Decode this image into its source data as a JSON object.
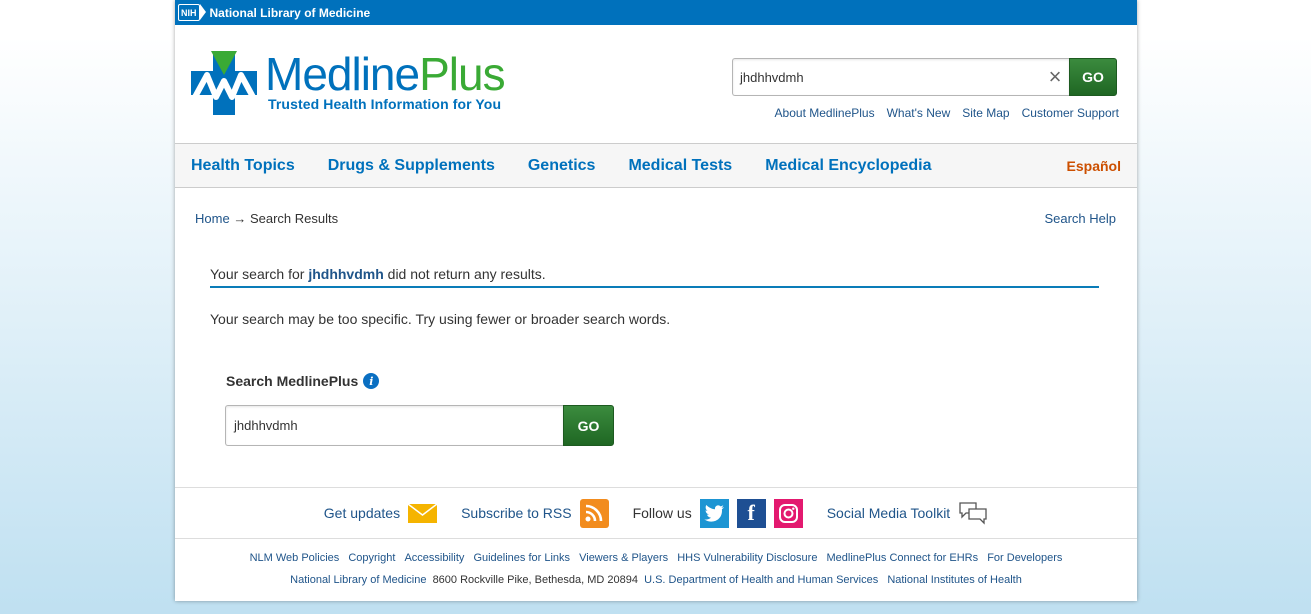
{
  "nih_bar": {
    "badge": "NIH",
    "label": "National Library of Medicine"
  },
  "logo": {
    "name_part1": "Medline",
    "name_part2": "Plus",
    "tagline": "Trusted Health Information for You"
  },
  "header_search": {
    "value": "jhdhhvdmh",
    "button": "GO"
  },
  "top_links": [
    "About MedlinePlus",
    "What's New",
    "Site Map",
    "Customer Support"
  ],
  "nav": {
    "items": [
      "Health Topics",
      "Drugs & Supplements",
      "Genetics",
      "Medical Tests",
      "Medical Encyclopedia"
    ],
    "espanol": "Español"
  },
  "breadcrumb": {
    "home": "Home",
    "arrow": "→",
    "current": "Search Results"
  },
  "search_help": "Search Help",
  "results": {
    "prefix": "Your search for",
    "query": "jhdhhvdmh",
    "suffix": "did not return any results.",
    "tip": "Your search may be too specific. Try using fewer or broader search words."
  },
  "search_box2": {
    "label": "Search MedlinePlus",
    "value": "jhdhhvdmh",
    "button": "GO"
  },
  "social": {
    "get_updates": "Get updates",
    "rss": "Subscribe to RSS",
    "follow": "Follow us",
    "toolkit": "Social Media Toolkit"
  },
  "footer_links": [
    "NLM Web Policies",
    "Copyright",
    "Accessibility",
    "Guidelines for Links",
    "Viewers & Players",
    "HHS Vulnerability Disclosure",
    "MedlinePlus Connect for EHRs",
    "For Developers"
  ],
  "footer_address": {
    "nlm": "National Library of Medicine",
    "address": "8600 Rockville Pike, Bethesda, MD 20894",
    "hhs": "U.S. Department of Health and Human Services",
    "nih": "National Institutes of Health"
  },
  "colors": {
    "brand_blue": "#0071bc",
    "brand_green": "#3aaa35",
    "go_green": "#2e7d32",
    "espanol": "#cc4f00"
  }
}
